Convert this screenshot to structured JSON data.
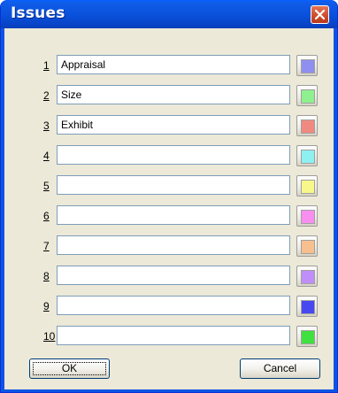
{
  "dialog": {
    "title": "Issues",
    "buttons": {
      "ok": "OK",
      "cancel": "Cancel"
    }
  },
  "rows": [
    {
      "number": "1",
      "value": "Appraisal",
      "color": "#8f8ff0"
    },
    {
      "number": "2",
      "value": "Size",
      "color": "#8ef08e"
    },
    {
      "number": "3",
      "value": "Exhibit",
      "color": "#f08a80"
    },
    {
      "number": "4",
      "value": "",
      "color": "#8ff0f0"
    },
    {
      "number": "5",
      "value": "",
      "color": "#f8f88a"
    },
    {
      "number": "6",
      "value": "",
      "color": "#f88ef0"
    },
    {
      "number": "7",
      "value": "",
      "color": "#f8c08e"
    },
    {
      "number": "8",
      "value": "",
      "color": "#c08ef8"
    },
    {
      "number": "9",
      "value": "",
      "color": "#4848f0"
    },
    {
      "number": "10",
      "value": "",
      "color": "#40e040"
    }
  ],
  "icons": {
    "close": "close-icon"
  }
}
